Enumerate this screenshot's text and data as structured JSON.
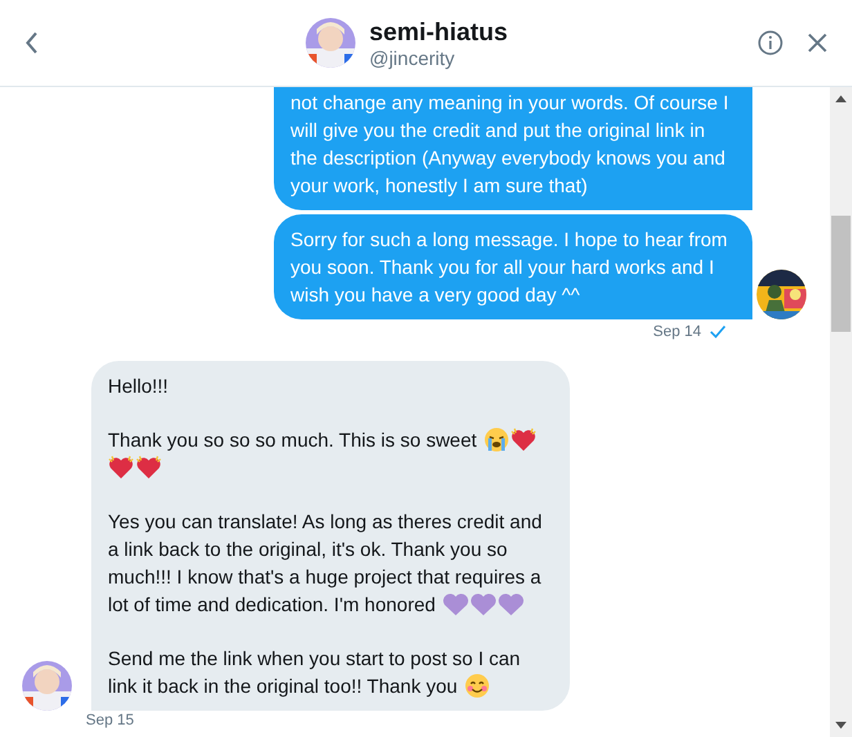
{
  "header": {
    "title": "semi-hiatus",
    "handle": "@jincerity"
  },
  "messages": [
    {
      "kind": "sent",
      "cut_top": true,
      "paragraphs": [
        {
          "lines": [
            {
              "text": "not change any meaning in your words. Of course I"
            },
            {
              "text": "will give you the credit and put the original link in"
            },
            {
              "text": "the description (Anyway everybody knows you and"
            },
            {
              "text": "your work, honestly I am sure that)"
            }
          ]
        }
      ]
    },
    {
      "kind": "sent",
      "cut_top": false,
      "paragraphs": [
        {
          "lines": [
            {
              "text": "Sorry for such a long message. I hope to hear from"
            },
            {
              "text": "you soon. Thank you for all your hard works and I"
            },
            {
              "text": "wish you have a very good day ^^"
            }
          ]
        }
      ],
      "avatar": true,
      "date": "Sep 14",
      "read": true
    },
    {
      "kind": "received",
      "cut_top": false,
      "paragraphs": [
        {
          "lines": [
            {
              "text": "Hello!!!"
            }
          ]
        },
        {
          "lines": [
            {
              "text": "Thank you so so so much. This is so sweet",
              "emoji": [
                {
                  "kind": "crying"
                },
                {
                  "kind": "heart"
                }
              ]
            },
            {
              "emoji": [
                {
                  "kind": "heart"
                },
                {
                  "kind": "heart"
                }
              ]
            }
          ]
        },
        {
          "lines": [
            {
              "text": "Yes you can translate! As long as theres credit and"
            },
            {
              "text": "a link back to the original, it's ok. Thank you so"
            },
            {
              "text": "much!!! I know that's a huge project that requires a"
            },
            {
              "text": "lot of time and dedication. I'm honored",
              "emoji": [
                {
                  "kind": "purple-heart"
                },
                {
                  "kind": "purple-heart"
                },
                {
                  "kind": "purple-heart"
                }
              ]
            }
          ]
        },
        {
          "lines": [
            {
              "text": "Send me the link when you start to post so I can"
            },
            {
              "text": "link it back in the original too!! Thank you",
              "emoji": [
                {
                  "kind": "smiling"
                }
              ]
            }
          ]
        }
      ],
      "avatar": true,
      "date": "Sep 15",
      "read": false
    }
  ]
}
